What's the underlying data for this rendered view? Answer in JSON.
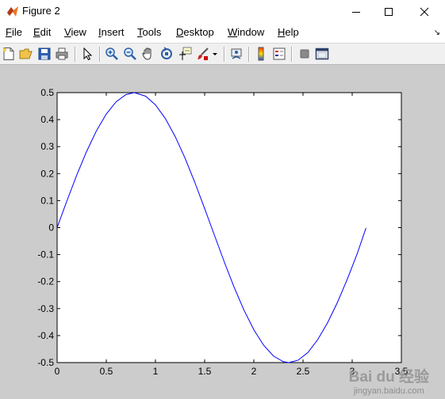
{
  "window": {
    "title": "Figure 2"
  },
  "menu": {
    "items": [
      {
        "first": "F",
        "rest": "ile"
      },
      {
        "first": "E",
        "rest": "dit"
      },
      {
        "first": "V",
        "rest": "iew"
      },
      {
        "first": "I",
        "rest": "nsert"
      },
      {
        "first": "T",
        "rest": "ools"
      },
      {
        "first": "D",
        "rest": "esktop"
      },
      {
        "first": "W",
        "rest": "indow"
      },
      {
        "first": "H",
        "rest": "elp"
      }
    ],
    "dock_arrow": "↘"
  },
  "toolbar": {
    "buttons": [
      "new-figure-icon",
      "open-file-icon",
      "save-icon",
      "print-icon",
      "edit-plot-arrow-icon",
      "zoom-in-icon",
      "zoom-out-icon",
      "pan-hand-icon",
      "rotate-3d-icon",
      "data-cursor-icon",
      "brush-icon",
      "link-plot-icon",
      "colorbar-icon",
      "legend-icon",
      "hide-plot-tools-icon",
      "show-plot-tools-icon"
    ]
  },
  "chart_data": {
    "type": "line",
    "function_shape": "0.5*sin(2x)",
    "x": [
      0,
      0.1,
      0.2,
      0.3,
      0.4,
      0.5,
      0.6,
      0.7,
      0.785,
      0.9,
      1.0,
      1.1,
      1.2,
      1.3,
      1.4,
      1.5,
      1.571,
      1.7,
      1.8,
      1.9,
      2.0,
      2.1,
      2.2,
      2.3,
      2.356,
      2.45,
      2.55,
      2.65,
      2.75,
      2.85,
      2.95,
      3.05,
      3.14
    ],
    "y": [
      0,
      0.0993,
      0.1947,
      0.2823,
      0.3587,
      0.4207,
      0.466,
      0.4927,
      0.5,
      0.4869,
      0.4546,
      0.4042,
      0.3377,
      0.2578,
      0.1675,
      0.0706,
      0.0,
      -0.1276,
      -0.2213,
      -0.306,
      -0.3784,
      -0.4358,
      -0.4758,
      -0.4968,
      -0.5,
      -0.4911,
      -0.4626,
      -0.4146,
      -0.3522,
      -0.2771,
      -0.1911,
      -0.0978,
      -0.0016
    ],
    "line_color": "#0000ff",
    "xlim": [
      0,
      3.5
    ],
    "ylim": [
      -0.5,
      0.5
    ],
    "xticks": [
      "0",
      "0.5",
      "1",
      "1.5",
      "2",
      "2.5",
      "3",
      "3.5"
    ],
    "yticks": [
      "0.5",
      "0.4",
      "0.3",
      "0.2",
      "0.1",
      "0",
      "-0.1",
      "-0.2",
      "-0.3",
      "-0.4",
      "-0.5"
    ],
    "grid": false
  },
  "watermark": {
    "logo": "Bai du 经验",
    "sub": "jingyan.baidu.com"
  }
}
